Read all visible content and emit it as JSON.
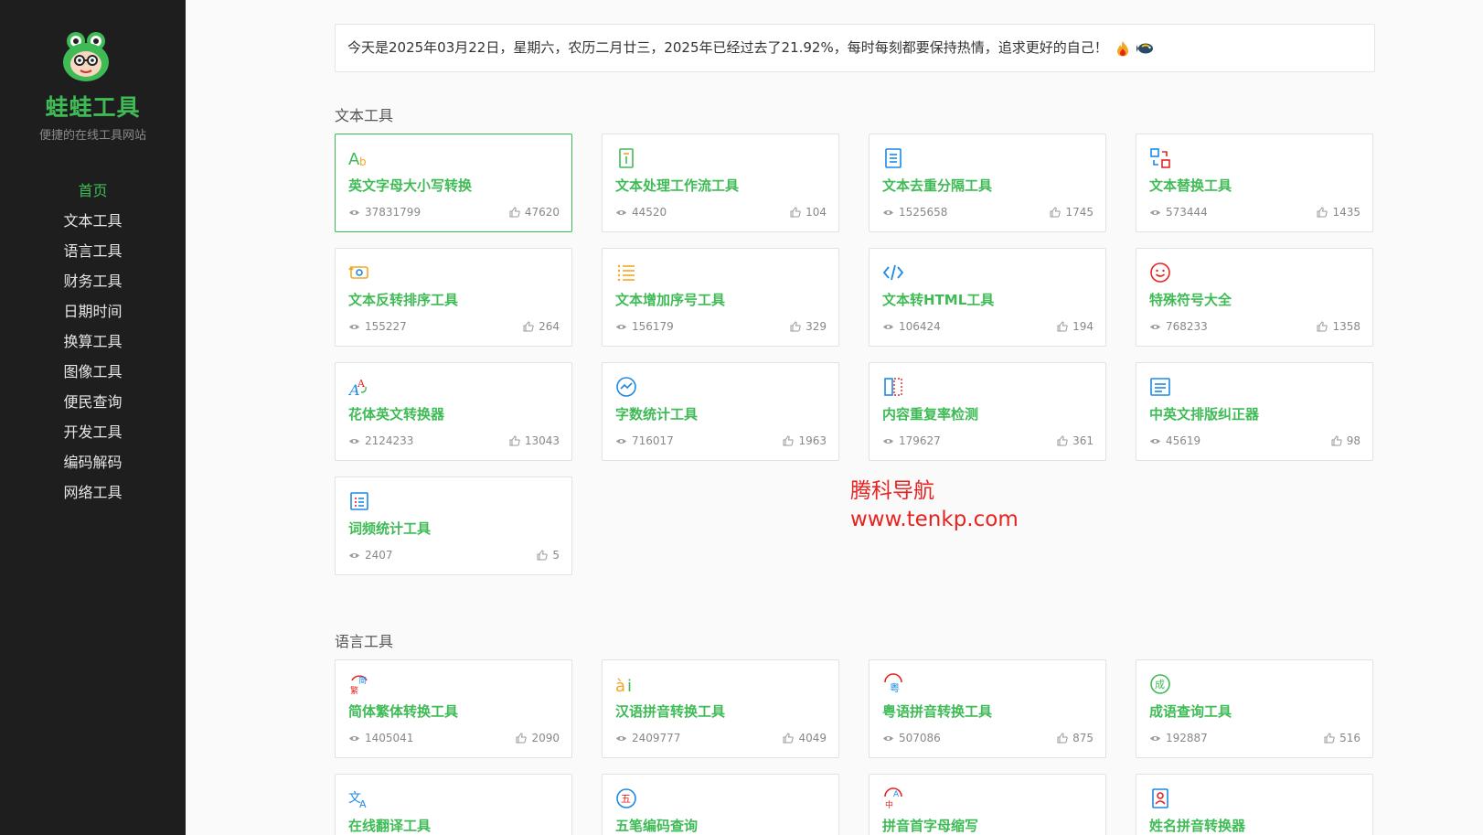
{
  "sidebar": {
    "site_name": "蛙蛙工具",
    "site_sub": "便捷的在线工具网站",
    "nav": [
      "首页",
      "文本工具",
      "语言工具",
      "财务工具",
      "日期时间",
      "换算工具",
      "图像工具",
      "便民查询",
      "开发工具",
      "编码解码",
      "网络工具"
    ]
  },
  "notice": {
    "text": "今天是2025年03月22日，星期六，农历二月廿三，2025年已经过去了21.92%，每时每刻都要保持热情，追求更好的自己！"
  },
  "sections": [
    {
      "title": "文本工具",
      "cards": [
        {
          "icon": "text-case-icon",
          "title": "英文字母大小写转换",
          "views": "37831799",
          "likes": "47620"
        },
        {
          "icon": "workflow-icon",
          "title": "文本处理工作流工具",
          "views": "44520",
          "likes": "104"
        },
        {
          "icon": "document-icon",
          "title": "文本去重分隔工具",
          "views": "1525658",
          "likes": "1745"
        },
        {
          "icon": "replace-icon",
          "title": "文本替换工具",
          "views": "573444",
          "likes": "1435"
        },
        {
          "icon": "reverse-icon",
          "title": "文本反转排序工具",
          "views": "155227",
          "likes": "264"
        },
        {
          "icon": "list-icon",
          "title": "文本增加序号工具",
          "views": "156179",
          "likes": "329"
        },
        {
          "icon": "code-icon",
          "title": "文本转HTML工具",
          "views": "106424",
          "likes": "194"
        },
        {
          "icon": "smiley-icon",
          "title": "特殊符号大全",
          "views": "768233",
          "likes": "1358"
        },
        {
          "icon": "fancy-font-icon",
          "title": "花体英文转换器",
          "views": "2124233",
          "likes": "13043"
        },
        {
          "icon": "chart-circle-icon",
          "title": "字数统计工具",
          "views": "716017",
          "likes": "1963"
        },
        {
          "icon": "compare-icon",
          "title": "内容重复率检测",
          "views": "179627",
          "likes": "361"
        },
        {
          "icon": "align-icon",
          "title": "中英文排版纠正器",
          "views": "45619",
          "likes": "98"
        },
        {
          "icon": "grid-list-icon",
          "title": "词频统计工具",
          "views": "2407",
          "likes": "5"
        }
      ]
    },
    {
      "title": "语言工具",
      "cards": [
        {
          "icon": "simplified-traditional-icon",
          "title": "简体繁体转换工具",
          "views": "1405041",
          "likes": "2090"
        },
        {
          "icon": "pinyin-icon",
          "title": "汉语拼音转换工具",
          "views": "2409777",
          "likes": "4049"
        },
        {
          "icon": "cantonese-icon",
          "title": "粤语拼音转换工具",
          "views": "507086",
          "likes": "875"
        },
        {
          "icon": "idiom-icon",
          "title": "成语查询工具",
          "views": "192887",
          "likes": "516"
        },
        {
          "icon": "translate-icon",
          "title": "在线翻译工具",
          "views": "",
          "likes": ""
        },
        {
          "icon": "wubi-icon",
          "title": "五笔编码查询",
          "views": "",
          "likes": ""
        },
        {
          "icon": "initials-icon",
          "title": "拼音首字母缩写",
          "views": "",
          "likes": ""
        },
        {
          "icon": "name-pinyin-icon",
          "title": "姓名拼音转换器",
          "views": "",
          "likes": ""
        }
      ]
    }
  ],
  "watermark": {
    "line1": "腾科导航",
    "line2": "www.tenkp.com"
  },
  "colors": {
    "accent": "#3fbb56",
    "sidebar_bg": "#1e1e1e",
    "watermark": "#e8231f"
  }
}
